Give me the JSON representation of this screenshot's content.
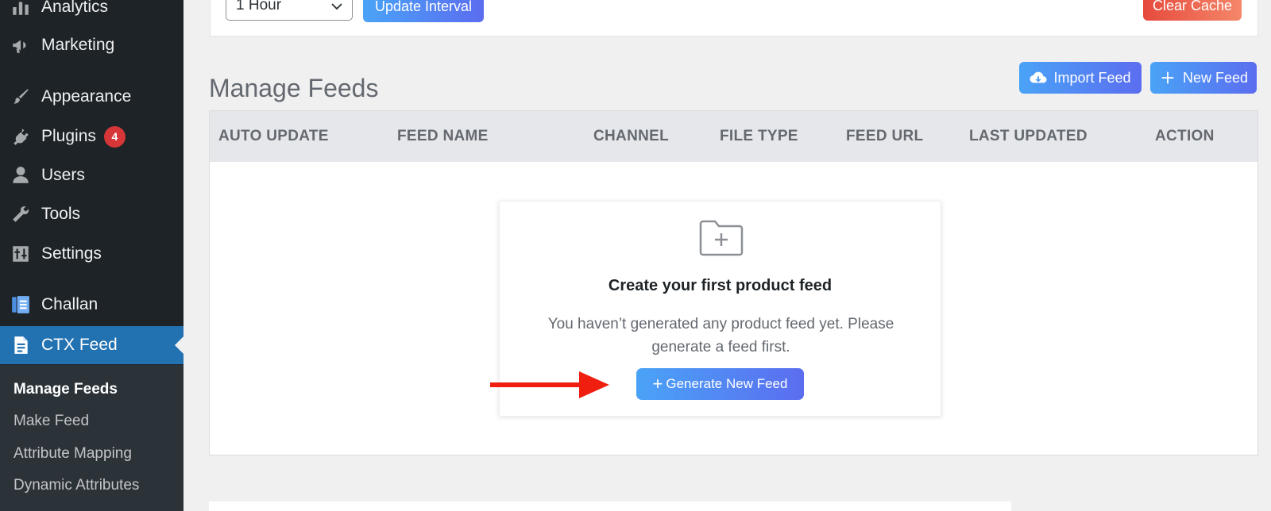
{
  "sidebar": {
    "items": [
      {
        "label": "Analytics",
        "icon": "bar-chart-icon"
      },
      {
        "label": "Marketing",
        "icon": "megaphone-icon"
      },
      {
        "label": "Appearance",
        "icon": "paintbrush-icon"
      },
      {
        "label": "Plugins",
        "icon": "plug-icon",
        "badge": "4"
      },
      {
        "label": "Users",
        "icon": "user-icon"
      },
      {
        "label": "Tools",
        "icon": "wrench-icon"
      },
      {
        "label": "Settings",
        "icon": "sliders-icon"
      },
      {
        "label": "Challan",
        "icon": "receipt-icon"
      },
      {
        "label": "CTX Feed",
        "icon": "document-icon",
        "active": true
      }
    ],
    "submenu": [
      {
        "label": "Manage Feeds",
        "current": true
      },
      {
        "label": "Make Feed"
      },
      {
        "label": "Attribute Mapping"
      },
      {
        "label": "Dynamic Attributes"
      }
    ]
  },
  "top": {
    "interval_value": "1 Hour",
    "update_interval_label": "Update Interval",
    "clear_cache_label": "Clear Cache"
  },
  "header": {
    "title": "Manage Feeds",
    "import_label": "Import Feed",
    "new_feed_label": "New Feed"
  },
  "table": {
    "columns": [
      "AUTO UPDATE",
      "FEED NAME",
      "CHANNEL",
      "FILE TYPE",
      "FEED URL",
      "LAST UPDATED",
      "ACTION"
    ]
  },
  "empty_state": {
    "title": "Create your first product feed",
    "text": "You haven’t generated any product feed yet. Please generate a feed first.",
    "button_label": "Generate New Feed"
  },
  "colors": {
    "sidebar_bg": "#1d2327",
    "active": "#2271b1",
    "badge": "#d63638",
    "arrow": "#f01e0e"
  }
}
